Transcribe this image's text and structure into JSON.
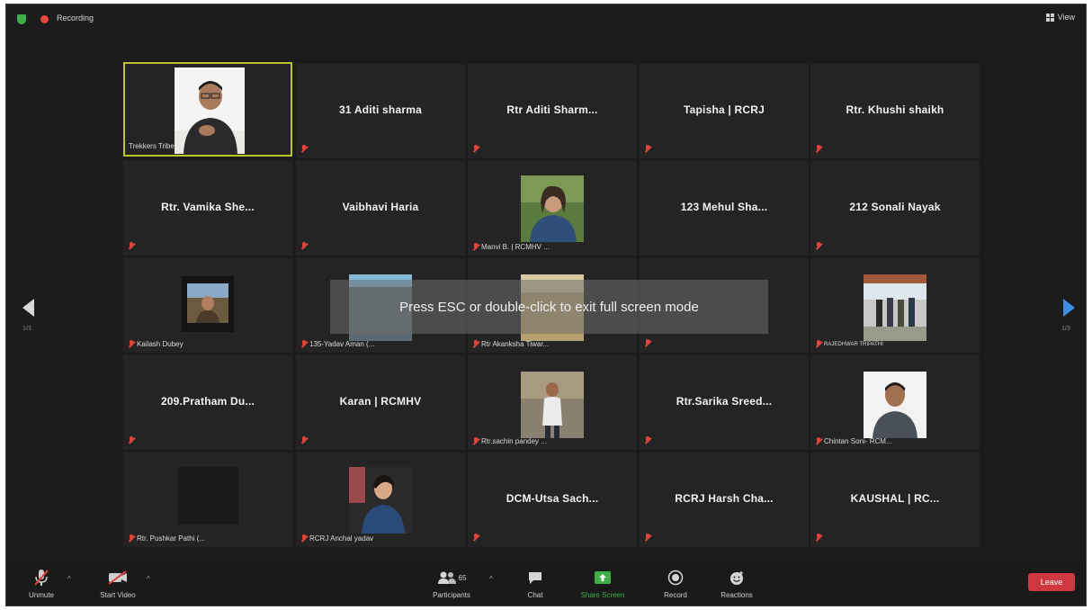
{
  "topbar": {
    "recording_label": "Recording",
    "view_label": "View"
  },
  "overlay": {
    "message": "Press ESC or double-click to exit full screen mode"
  },
  "pagination": {
    "left": "1/3",
    "right": "1/3"
  },
  "tiles": [
    {
      "type": "video",
      "label": "Trekkers Tribe"
    },
    {
      "type": "name",
      "name": "31 Aditi sharma"
    },
    {
      "type": "name",
      "name": "Rtr Aditi Sharm..."
    },
    {
      "type": "name",
      "name": "Tapisha | RCRJ"
    },
    {
      "type": "name",
      "name": "Rtr. Khushi shaikh"
    },
    {
      "type": "name",
      "name": "Rtr. Vamika She..."
    },
    {
      "type": "name",
      "name": "Vaibhavi Haria"
    },
    {
      "type": "photo",
      "label": "Manvi B. | RCMHV ..."
    },
    {
      "type": "name",
      "name": "123 Mehul Sha..."
    },
    {
      "type": "name",
      "name": "212 Sonali Nayak"
    },
    {
      "type": "photo",
      "label": "Kailash Dubey"
    },
    {
      "type": "photo",
      "label": "135-Yadav Aman (..."
    },
    {
      "type": "photo",
      "label": "Rtr Akanksha Tiwar..."
    },
    {
      "type": "name",
      "name": ""
    },
    {
      "type": "photo",
      "label": "RAJEDHWAR TRIPATHI"
    },
    {
      "type": "name",
      "name": "209.Pratham Du..."
    },
    {
      "type": "name",
      "name": "Karan | RCMHV"
    },
    {
      "type": "photo",
      "label": "Rtr.sachin pandey ..."
    },
    {
      "type": "name",
      "name": "Rtr.Sarika Sreed..."
    },
    {
      "type": "photo",
      "label": "Chintan Soni- RCM..."
    },
    {
      "type": "photo",
      "label": "Rtr. Pushkar Pathi (..."
    },
    {
      "type": "photo",
      "label": "RCRJ Anchal yadav"
    },
    {
      "type": "name",
      "name": "DCM-Utsa Sach..."
    },
    {
      "type": "name",
      "name": "RCRJ Harsh Cha..."
    },
    {
      "type": "name",
      "name": "KAUSHAL | RC..."
    }
  ],
  "toolbar": {
    "unmute": "Unmute",
    "start_video": "Start Video",
    "participants": "Participants",
    "participants_count": "65",
    "chat": "Chat",
    "share_screen": "Share Screen",
    "record": "Record",
    "reactions": "Reactions",
    "leave": "Leave"
  },
  "colors": {
    "active_speaker_border": "#b9c72d",
    "share_screen_green": "#3fae49",
    "leave_red": "#d0383f",
    "next_arrow_blue": "#3c8fe6"
  }
}
